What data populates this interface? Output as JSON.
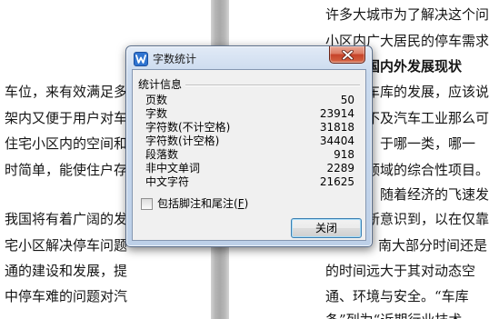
{
  "document": {
    "left_page_lines": [
      "车位，来有效满足多",
      "架内又便于用户对车",
      "住宅小区内的空间和",
      "时简单，能使住户存",
      "我国将有着广阔的发",
      "宅小区解决停车问题",
      "通的建设和发展，提",
      "中停车难的问题对汽"
    ],
    "right_page_lines": [
      "许多大城市为了解决这个问",
      "小区内广大居民的停车需求",
      "国内外发展现状",
      "车库的发展，应该说",
      "不及汽车工业那么可",
      "于哪一类，哪一",
      "领域的综合性项目。",
      "随着经济的飞速发",
      "新意识到，以在仅靠",
      "南大部分时间还是",
      "的时间远大于其对动态空",
      "通、环境与安全。“车库",
      "条”列为“近期行业技术"
    ]
  },
  "dialog": {
    "title": "字数统计",
    "icon": "wps-writer-icon",
    "close_icon": "close-icon",
    "group_label": "统计信息",
    "stats": [
      {
        "label": "页数",
        "value": "50"
      },
      {
        "label": "字数",
        "value": "23914"
      },
      {
        "label": "字符数(不计空格)",
        "value": "31818"
      },
      {
        "label": "字符数(计空格)",
        "value": "34404"
      },
      {
        "label": "段落数",
        "value": "918"
      },
      {
        "label": "非中文单词",
        "value": "2289"
      },
      {
        "label": "中文字符",
        "value": "21625"
      }
    ],
    "checkbox": {
      "label_prefix": "包括脚注和尾注(",
      "accesskey": "F",
      "label_suffix": ")",
      "checked": false
    },
    "close_button_label": "关闭"
  },
  "colors": {
    "wps_brand": "#2f74d0",
    "close_red": "#c6432a",
    "default_button_border": "#3c7fb1",
    "page_gap": "#a9a9a9"
  }
}
